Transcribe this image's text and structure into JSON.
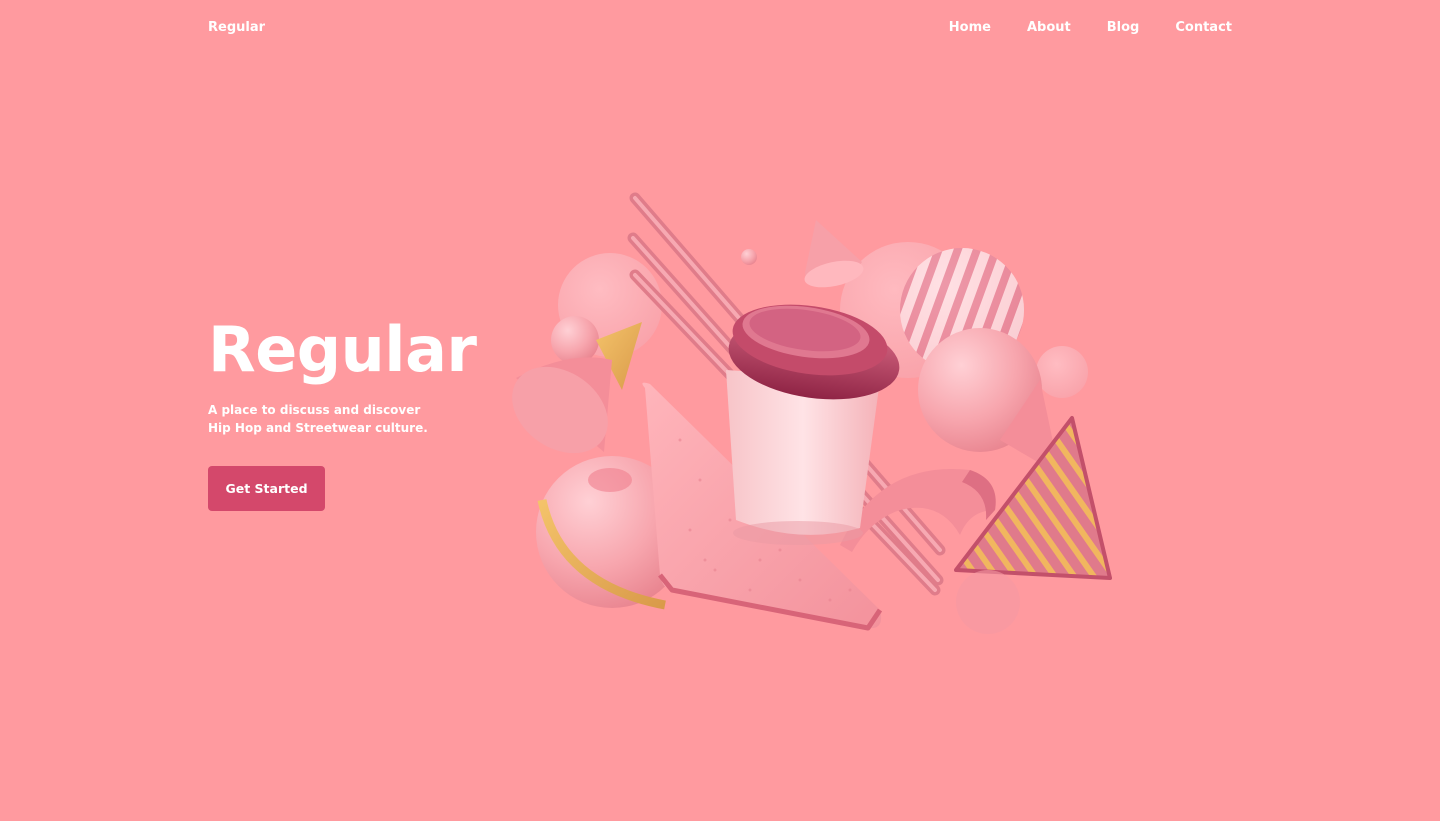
{
  "brand": "Regular",
  "nav": {
    "items": [
      "Home",
      "About",
      "Blog",
      "Contact"
    ]
  },
  "hero": {
    "title": "Regular",
    "subtitle_line1": "A place to discuss and discover",
    "subtitle_line2": "Hip Hop and Streetwear culture.",
    "cta_label": "Get Started"
  },
  "colors": {
    "background": "#ff9a9f",
    "button": "#d4486b",
    "text": "#ffffff"
  },
  "illustration": "abstract-3d-shapes-coffee-cup"
}
